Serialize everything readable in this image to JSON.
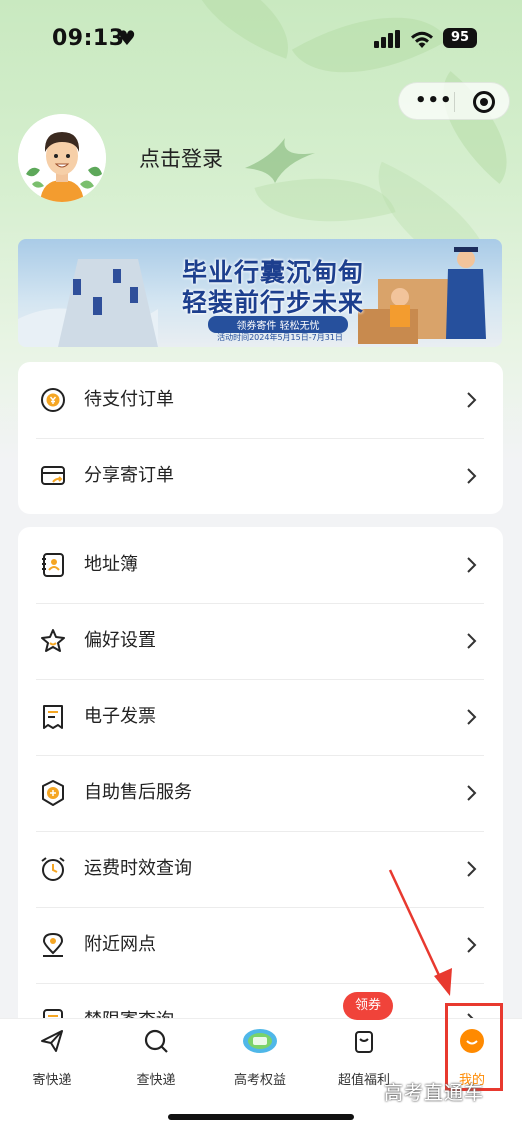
{
  "status_bar": {
    "time": "09:13",
    "heart": "♥",
    "battery": "95"
  },
  "profile": {
    "login_label": "点击登录"
  },
  "banner": {
    "title_line1": "毕业行囊沉甸甸",
    "title_line2": "轻装前行步未来",
    "subtitle": "领券寄件 轻松无忧",
    "date": "活动时间2024年5月15日-7月31日"
  },
  "orders_section": {
    "items": [
      {
        "label": "待支付订单",
        "icon": "yen-circle-icon"
      },
      {
        "label": "分享寄订单",
        "icon": "share-card-icon"
      }
    ]
  },
  "services_section": {
    "items": [
      {
        "label": "地址簿",
        "icon": "address-book-icon"
      },
      {
        "label": "偏好设置",
        "icon": "star-icon"
      },
      {
        "label": "电子发票",
        "icon": "invoice-icon"
      },
      {
        "label": "自助售后服务",
        "icon": "after-sales-shield-icon"
      },
      {
        "label": "运费时效查询",
        "icon": "alarm-clock-icon"
      },
      {
        "label": "附近网点",
        "icon": "location-pin-icon"
      },
      {
        "label": "禁限寄查询",
        "icon": "prohibited-items-icon"
      }
    ]
  },
  "tab_bar": {
    "coupon_badge": "领券",
    "tabs": [
      {
        "label": "寄快递",
        "icon": "send-plane-icon"
      },
      {
        "label": "查快递",
        "icon": "search-icon"
      },
      {
        "label": "高考权益",
        "icon": "gaokao-badge-icon"
      },
      {
        "label": "超值福利",
        "icon": "gift-bag-icon"
      },
      {
        "label": "我的",
        "icon": "smile-face-icon",
        "active": true
      }
    ]
  },
  "watermark": "高考直通车",
  "colors": {
    "accent": "#ff8a00",
    "highlight_red": "#e8392f",
    "badge_red": "#f0433a"
  }
}
